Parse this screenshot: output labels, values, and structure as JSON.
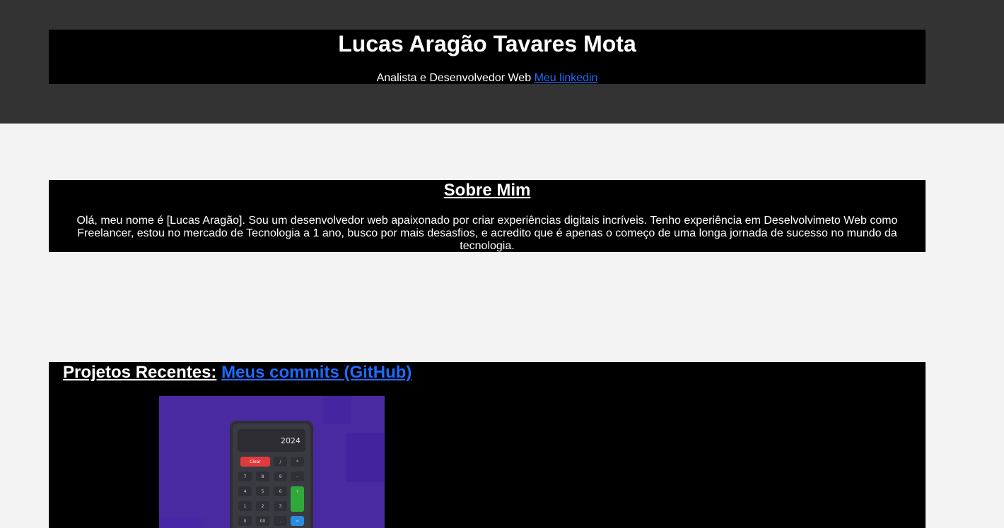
{
  "header": {
    "name": "Lucas Aragão Tavares Mota",
    "subtitle": "Analista e Desenvolvedor Web",
    "linkedin_label": "Meu linkedin"
  },
  "about": {
    "title": "Sobre Mim",
    "text": "Olá, meu nome é [Lucas Aragão]. Sou um desenvolvedor web apaixonado por criar experiências digitais incríveis. Tenho experiência em Deselvolvimeto Web como Freelancer, estou no mercado de Tecnologia a 1 ano, busco por mais desasfios, e acredito que é apenas o começo de uma longa jornada de sucesso no mundo da tecnologia."
  },
  "projects": {
    "title": "Projetos Recentes:",
    "github_label": "Meus commits (GitHub)",
    "items": [
      {
        "display": "2024",
        "keys": [
          "Clear",
          "/",
          "*",
          "7",
          "8",
          "9",
          "-",
          "4",
          "5",
          "6",
          "+",
          "1",
          "2",
          "3",
          "0",
          "00",
          ".",
          "="
        ]
      }
    ]
  },
  "colors": {
    "page_bg": "#f3f3f3",
    "top_band": "#333333",
    "panel_bg": "#000000",
    "link": "#1e6bff",
    "thumb_bg": "#4a2aa0"
  }
}
